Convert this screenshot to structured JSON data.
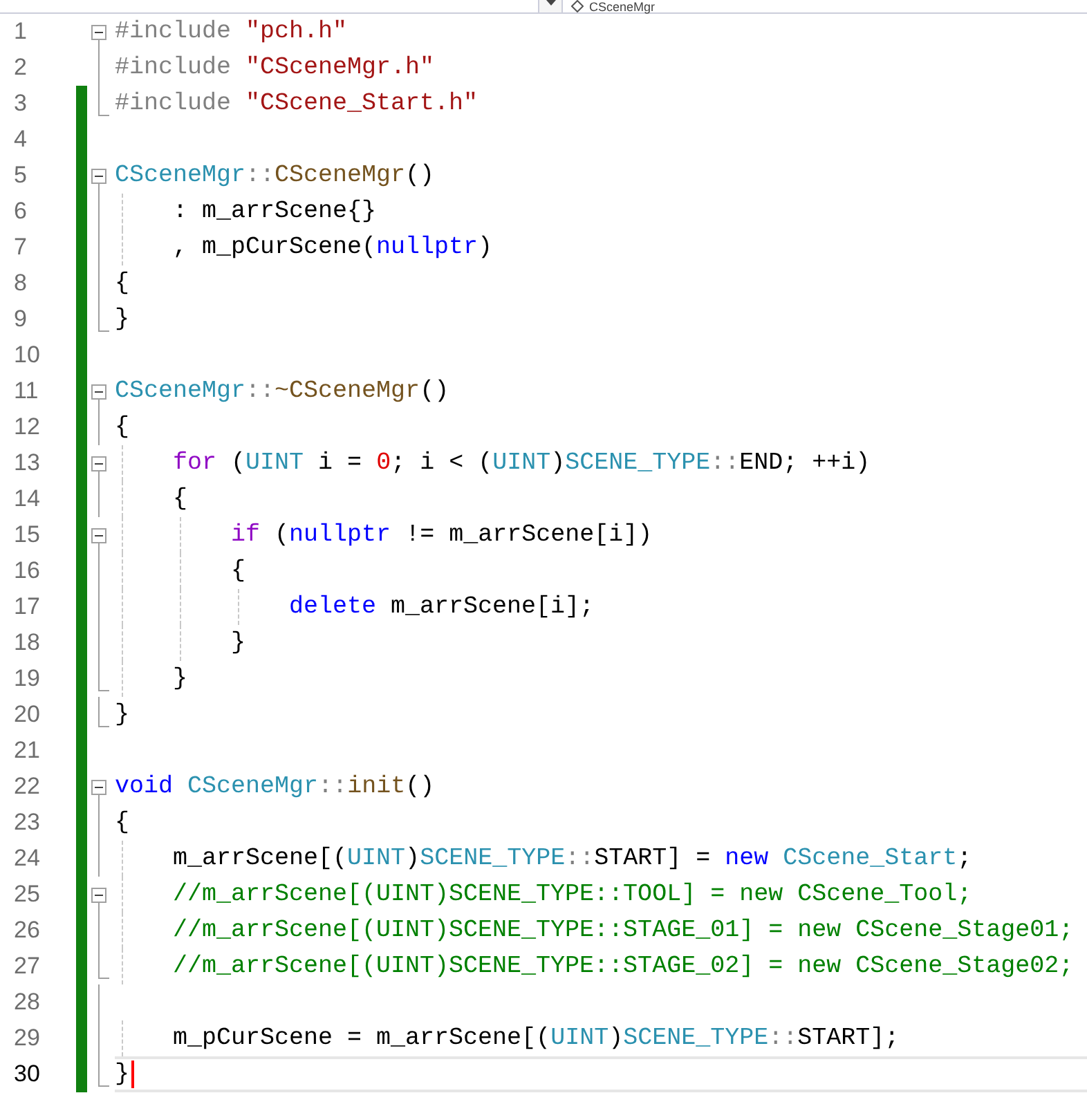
{
  "navigation_bar": {
    "member": "CSceneMgr"
  },
  "lines": [
    {
      "number": "1",
      "changed": false,
      "collapse_toggle": true,
      "fold_guide": false,
      "fold_end": false,
      "current": false,
      "tokens": [
        {
          "kind": "pre",
          "text": "#include "
        },
        {
          "kind": "str",
          "text": "\"pch.h\""
        }
      ]
    },
    {
      "number": "2",
      "changed": false,
      "collapse_toggle": false,
      "fold_guide": true,
      "fold_end": false,
      "current": false,
      "tokens": [
        {
          "kind": "pre",
          "text": "#include "
        },
        {
          "kind": "str",
          "text": "\"CSceneMgr.h\""
        }
      ]
    },
    {
      "number": "3",
      "changed": true,
      "collapse_toggle": false,
      "fold_guide": false,
      "fold_end": true,
      "current": false,
      "tokens": [
        {
          "kind": "pre",
          "text": "#include "
        },
        {
          "kind": "str",
          "text": "\"CScene_Start.h\""
        }
      ]
    },
    {
      "number": "4",
      "changed": true,
      "collapse_toggle": false,
      "fold_guide": false,
      "fold_end": false,
      "current": false
    },
    {
      "number": "5",
      "changed": true,
      "collapse_toggle": true,
      "fold_guide": false,
      "fold_end": false,
      "current": false,
      "tokens": [
        {
          "kind": "type",
          "text": "CSceneMgr"
        },
        {
          "kind": "punct",
          "text": "::"
        },
        {
          "kind": "fn",
          "text": "CSceneMgr"
        },
        {
          "kind": "plain",
          "text": "()"
        }
      ]
    },
    {
      "number": "6",
      "changed": true,
      "collapse_toggle": false,
      "fold_guide": true,
      "fold_end": false,
      "current": false,
      "tokens": [
        {
          "kind": "plain",
          "text": "    : m_arrScene{}"
        }
      ]
    },
    {
      "number": "7",
      "changed": true,
      "collapse_toggle": false,
      "fold_guide": true,
      "fold_end": false,
      "current": false,
      "tokens": [
        {
          "kind": "plain",
          "text": "    , m_pCurScene("
        },
        {
          "kind": "kw",
          "text": "nullptr"
        },
        {
          "kind": "plain",
          "text": ")"
        }
      ]
    },
    {
      "number": "8",
      "changed": true,
      "collapse_toggle": false,
      "fold_guide": true,
      "fold_end": false,
      "current": false,
      "tokens": [
        {
          "kind": "plain",
          "text": "{"
        }
      ]
    },
    {
      "number": "9",
      "changed": true,
      "collapse_toggle": false,
      "fold_guide": false,
      "fold_end": true,
      "current": false,
      "tokens": [
        {
          "kind": "plain",
          "text": "}"
        }
      ]
    },
    {
      "number": "10",
      "changed": true,
      "collapse_toggle": false,
      "fold_guide": false,
      "fold_end": false,
      "current": false
    },
    {
      "number": "11",
      "changed": true,
      "collapse_toggle": true,
      "fold_guide": false,
      "fold_end": false,
      "current": false,
      "tokens": [
        {
          "kind": "type",
          "text": "CSceneMgr"
        },
        {
          "kind": "punct",
          "text": "::"
        },
        {
          "kind": "fn",
          "text": "~CSceneMgr"
        },
        {
          "kind": "plain",
          "text": "()"
        }
      ]
    },
    {
      "number": "12",
      "changed": true,
      "collapse_toggle": false,
      "fold_guide": true,
      "fold_end": false,
      "current": false,
      "tokens": [
        {
          "kind": "plain",
          "text": "{"
        }
      ]
    },
    {
      "number": "13",
      "changed": true,
      "collapse_toggle": true,
      "fold_guide": false,
      "fold_end": false,
      "current": false,
      "tokens": [
        {
          "kind": "ctl",
          "text": "    for"
        },
        {
          "kind": "plain",
          "text": " ("
        },
        {
          "kind": "type",
          "text": "UINT"
        },
        {
          "kind": "plain",
          "text": " i = "
        },
        {
          "kind": "num",
          "text": "0"
        },
        {
          "kind": "plain",
          "text": "; i < ("
        },
        {
          "kind": "type",
          "text": "UINT"
        },
        {
          "kind": "plain",
          "text": ")"
        },
        {
          "kind": "type",
          "text": "SCENE_TYPE"
        },
        {
          "kind": "punct",
          "text": "::"
        },
        {
          "kind": "plain",
          "text": "END; ++i)"
        }
      ]
    },
    {
      "number": "14",
      "changed": true,
      "collapse_toggle": false,
      "fold_guide": true,
      "fold_end": false,
      "current": false,
      "tokens": [
        {
          "kind": "plain",
          "text": "    {"
        }
      ]
    },
    {
      "number": "15",
      "changed": true,
      "collapse_toggle": true,
      "fold_guide": false,
      "fold_end": false,
      "current": false,
      "tokens": [
        {
          "kind": "ctl",
          "text": "        if"
        },
        {
          "kind": "plain",
          "text": " ("
        },
        {
          "kind": "kw",
          "text": "nullptr"
        },
        {
          "kind": "plain",
          "text": " != m_arrScene[i])"
        }
      ]
    },
    {
      "number": "16",
      "changed": true,
      "collapse_toggle": false,
      "fold_guide": true,
      "fold_end": false,
      "current": false,
      "tokens": [
        {
          "kind": "plain",
          "text": "        {"
        }
      ]
    },
    {
      "number": "17",
      "changed": true,
      "collapse_toggle": false,
      "fold_guide": true,
      "fold_end": false,
      "current": false,
      "tokens": [
        {
          "kind": "kw",
          "text": "            delete"
        },
        {
          "kind": "plain",
          "text": " m_arrScene[i];"
        }
      ]
    },
    {
      "number": "18",
      "changed": true,
      "collapse_toggle": false,
      "fold_guide": true,
      "fold_end": false,
      "current": false,
      "tokens": [
        {
          "kind": "plain",
          "text": "        }"
        }
      ]
    },
    {
      "number": "19",
      "changed": true,
      "collapse_toggle": false,
      "fold_guide": false,
      "fold_end": true,
      "current": false,
      "tokens": [
        {
          "kind": "plain",
          "text": "    }"
        }
      ]
    },
    {
      "number": "20",
      "changed": true,
      "collapse_toggle": false,
      "fold_guide": false,
      "fold_end": true,
      "current": false,
      "tokens": [
        {
          "kind": "plain",
          "text": "}"
        }
      ]
    },
    {
      "number": "21",
      "changed": true,
      "collapse_toggle": false,
      "fold_guide": false,
      "fold_end": false,
      "current": false
    },
    {
      "number": "22",
      "changed": true,
      "collapse_toggle": true,
      "fold_guide": false,
      "fold_end": false,
      "current": false,
      "tokens": [
        {
          "kind": "kw",
          "text": "void"
        },
        {
          "kind": "type",
          "text": " CSceneMgr"
        },
        {
          "kind": "punct",
          "text": "::"
        },
        {
          "kind": "fn",
          "text": "init"
        },
        {
          "kind": "plain",
          "text": "()"
        }
      ]
    },
    {
      "number": "23",
      "changed": true,
      "collapse_toggle": false,
      "fold_guide": true,
      "fold_end": false,
      "current": false,
      "tokens": [
        {
          "kind": "plain",
          "text": "{"
        }
      ]
    },
    {
      "number": "24",
      "changed": true,
      "collapse_toggle": false,
      "fold_guide": true,
      "fold_end": false,
      "current": false,
      "tokens": [
        {
          "kind": "plain",
          "text": "    m_arrScene[("
        },
        {
          "kind": "type",
          "text": "UINT"
        },
        {
          "kind": "plain",
          "text": ")"
        },
        {
          "kind": "type",
          "text": "SCENE_TYPE"
        },
        {
          "kind": "punct",
          "text": "::"
        },
        {
          "kind": "plain",
          "text": "START] = "
        },
        {
          "kind": "kw",
          "text": "new"
        },
        {
          "kind": "type",
          "text": " CScene_Start"
        },
        {
          "kind": "plain",
          "text": ";"
        }
      ]
    },
    {
      "number": "25",
      "changed": true,
      "collapse_toggle": true,
      "fold_guide": false,
      "fold_end": false,
      "current": false,
      "tokens": [
        {
          "kind": "cmt",
          "text": "    //m_arrScene[(UINT)SCENE_TYPE::TOOL] = new CScene_Tool;"
        }
      ]
    },
    {
      "number": "26",
      "changed": true,
      "collapse_toggle": false,
      "fold_guide": true,
      "fold_end": false,
      "current": false,
      "tokens": [
        {
          "kind": "cmt",
          "text": "    //m_arrScene[(UINT)SCENE_TYPE::STAGE_01] = new CScene_Stage01;"
        }
      ]
    },
    {
      "number": "27",
      "changed": true,
      "collapse_toggle": false,
      "fold_guide": false,
      "fold_end": true,
      "current": false,
      "tokens": [
        {
          "kind": "cmt",
          "text": "    //m_arrScene[(UINT)SCENE_TYPE::STAGE_02] = new CScene_Stage02;"
        }
      ]
    },
    {
      "number": "28",
      "changed": true,
      "collapse_toggle": false,
      "fold_guide": true,
      "fold_end": false,
      "current": false
    },
    {
      "number": "29",
      "changed": true,
      "collapse_toggle": false,
      "fold_guide": true,
      "fold_end": false,
      "current": false,
      "tokens": [
        {
          "kind": "plain",
          "text": "    m_pCurScene = m_arrScene[("
        },
        {
          "kind": "type",
          "text": "UINT"
        },
        {
          "kind": "plain",
          "text": ")"
        },
        {
          "kind": "type",
          "text": "SCENE_TYPE"
        },
        {
          "kind": "punct",
          "text": "::"
        },
        {
          "kind": "plain",
          "text": "START];"
        }
      ]
    },
    {
      "number": "30",
      "changed": true,
      "collapse_toggle": false,
      "fold_guide": false,
      "fold_end": true,
      "current": true,
      "tokens": [
        {
          "kind": "plain",
          "text": "}"
        }
      ]
    }
  ]
}
